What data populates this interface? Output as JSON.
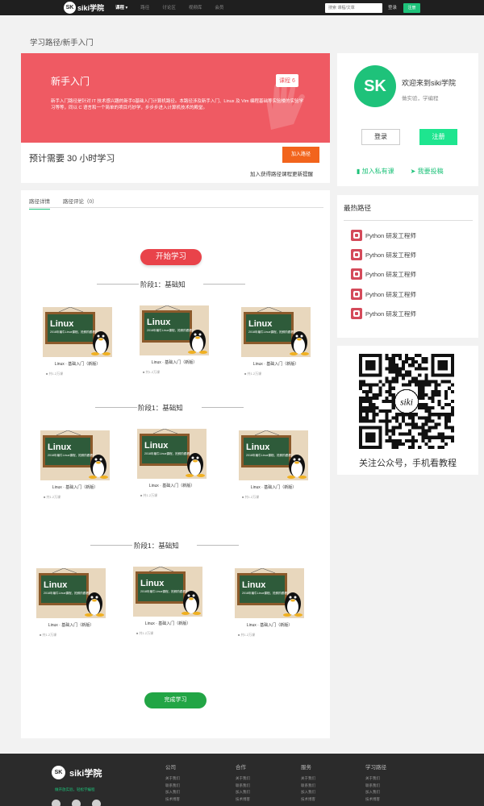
{
  "nav": {
    "logo_text": "siki学院",
    "logo_mark": "SK",
    "items": [
      {
        "label": "课程 ▾",
        "active": true
      },
      {
        "label": "路径",
        "active": false
      },
      {
        "label": "讨论区",
        "active": false
      },
      {
        "label": "视频库",
        "active": false
      },
      {
        "label": "会员",
        "active": false
      }
    ],
    "search_placeholder": "搜索 课程/文章",
    "login": "登录",
    "register": "注册"
  },
  "breadcrumb": "学习路径/新手入门",
  "hero": {
    "title": "新手入门",
    "course_count": "课程 6",
    "description": "新手入门路径是针对 IT 技术感兴趣的新手0基础入门计算机路径。本路径涉及新手入门、Linux 及 Vim 编程基础等实验楼的实验学习等等，同以 C 语言和一个简单的项目巧妙学，步步步进入计算机技术的殿堂。",
    "hours": "预计需要 30 小时学习",
    "join_button": "加入路径",
    "join_tip": "加入获得路径课程更新提醒"
  },
  "profile": {
    "avatar_text": "SK",
    "welcome": "欢迎来到siki学院",
    "subtitle": "做实验，学编程",
    "login": "登录",
    "register": "注册",
    "link_private": "加入私有课",
    "link_submit": "我要投稿"
  },
  "tabs": [
    "路径详情",
    "路径评论（0）"
  ],
  "start_button": "开始学习",
  "stages": [
    {
      "title": "阶段1：基础知",
      "courses": [
        {
          "title": "Linux · 基础入门（新版）",
          "meta": "共1.2万课",
          "board_title": "Linux",
          "board_text": "2018年最牛Linux课程，抢鲜阶跟看！"
        },
        {
          "title": "Linux · 基础入门（新版）",
          "meta": "共1.2万课",
          "board_title": "Linux",
          "board_text": "2018年最牛Linux课程，抢鲜阶跟看！"
        },
        {
          "title": "Linux · 基础入门（新版）",
          "meta": "共1.2万课",
          "board_title": "Linux",
          "board_text": "2018年最牛Linux课程，抢鲜阶跟看！"
        }
      ]
    },
    {
      "title": "阶段1：基础知",
      "courses": [
        {
          "title": "Linux · 基础入门（新版）",
          "meta": "共1.2万课",
          "board_title": "Linux",
          "board_text": "2018年最牛Linux课程，抢鲜阶跟看！"
        },
        {
          "title": "Linux · 基础入门（新版）",
          "meta": "共1.2万课",
          "board_title": "Linux",
          "board_text": "2018年最牛Linux课程，抢鲜阶跟看！"
        },
        {
          "title": "Linux · 基础入门（新版）",
          "meta": "共1.2万课",
          "board_title": "Linux",
          "board_text": "2018年最牛Linux课程，抢鲜阶跟看！"
        }
      ]
    },
    {
      "title": "阶段1：基础知",
      "courses": [
        {
          "title": "Linux · 基础入门（新版）",
          "meta": "共1.2万课",
          "board_title": "Linux",
          "board_text": "2018年最牛Linux课程，抢鲜阶跟看！"
        },
        {
          "title": "Linux · 基础入门（新版）",
          "meta": "共1.2万课",
          "board_title": "Linux",
          "board_text": "2018年最牛Linux课程，抢鲜阶跟看！"
        },
        {
          "title": "Linux · 基础入门（新版）",
          "meta": "共1.2万课",
          "board_title": "Linux",
          "board_text": "2018年最牛Linux课程，抢鲜阶跟看！"
        }
      ]
    }
  ],
  "finish_button": "完成学习",
  "hot": {
    "title": "最热路径",
    "items": [
      "Python 研发工程师",
      "Python 研发工程师",
      "Python 研发工程师",
      "Python 研发工程师",
      "Python 研发工程师"
    ]
  },
  "qr": {
    "caption": "关注公众号，手机看教程",
    "center_text": "siki"
  },
  "footer": {
    "logo_text": "siki学院",
    "logo_mark": "SK",
    "slogan": "做开放实验，轻松学编程",
    "columns": [
      {
        "title": "公司",
        "links": [
          "关于我们",
          "联系我们",
          "加入我们",
          "技术博客"
        ]
      },
      {
        "title": "合作",
        "links": [
          "关于我们",
          "联系我们",
          "加入我们",
          "技术博客"
        ]
      },
      {
        "title": "服务",
        "links": [
          "关于我们",
          "联系我们",
          "加入我们",
          "技术博客"
        ]
      },
      {
        "title": "学习路径",
        "links": [
          "关于我们",
          "联系我们",
          "加入我们",
          "技术博客"
        ]
      }
    ]
  },
  "colors": {
    "hero": "#ef5a63",
    "accent_green": "#1ec27a",
    "start_red": "#e9434a",
    "finish_green": "#22a545",
    "join_orange": "#f2641c"
  }
}
